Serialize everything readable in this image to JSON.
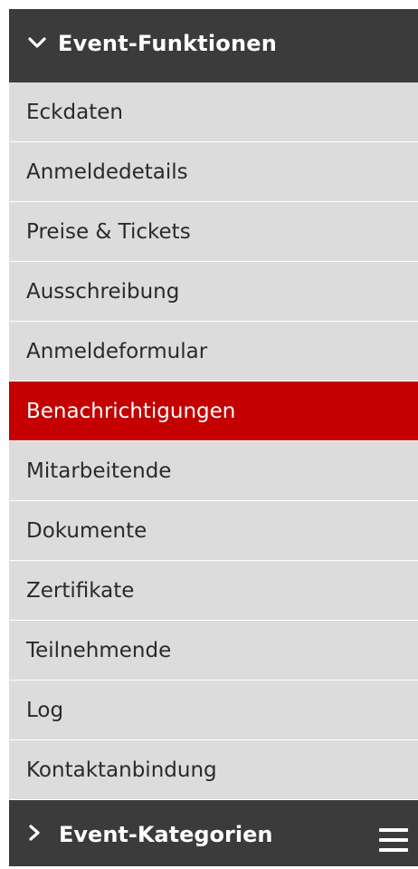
{
  "header": {
    "title": "Event-Funktionen",
    "icon": "chevron-down-icon"
  },
  "menu": {
    "items": [
      {
        "label": "Eckdaten",
        "active": false
      },
      {
        "label": "Anmeldedetails",
        "active": false
      },
      {
        "label": "Preise & Tickets",
        "active": false
      },
      {
        "label": "Ausschreibung",
        "active": false
      },
      {
        "label": "Anmeldeformular",
        "active": false
      },
      {
        "label": "Benachrichtigungen",
        "active": true
      },
      {
        "label": "Mitarbeitende",
        "active": false
      },
      {
        "label": "Dokumente",
        "active": false
      },
      {
        "label": "Zertifikate",
        "active": false
      },
      {
        "label": "Teilnehmende",
        "active": false
      },
      {
        "label": "Log",
        "active": false
      },
      {
        "label": "Kontaktanbindung",
        "active": false
      }
    ]
  },
  "footer": {
    "title": "Event-Kategorien",
    "icon": "chevron-right-icon",
    "menu_icon": "hamburger-menu-icon"
  },
  "colors": {
    "header_bg": "#3b3b3b",
    "item_bg": "#dcdcdc",
    "active_bg": "#c40000",
    "active_text": "#ffffff"
  }
}
